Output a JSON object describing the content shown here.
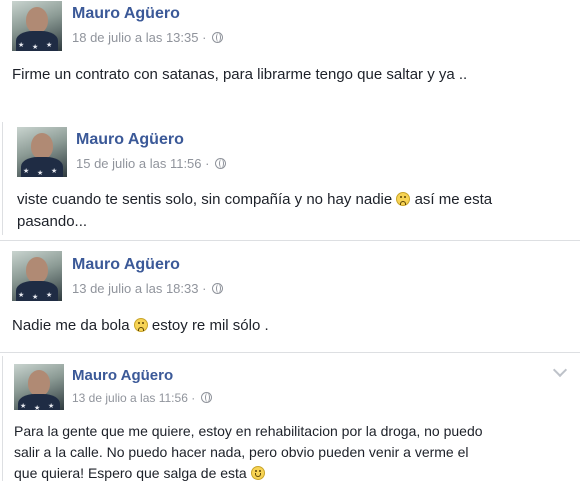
{
  "posts": [
    {
      "author": "Mauro Agüero",
      "date": "18 de julio a las 13:35",
      "separator": "·",
      "text": "Firme un contrato con satanas, para librarme tengo que saltar y ya .."
    },
    {
      "author": "Mauro Agüero",
      "date": "15 de julio a las 11:56",
      "separator": "·",
      "text_line1_a": "viste cuando te sentis solo, sin compañía y no hay nadie",
      "text_line1_b": "así me esta",
      "text_line2": "pasando..."
    },
    {
      "author": "Mauro Agüero",
      "date": "13 de julio a las 18:33",
      "separator": "·",
      "text_a": "Nadie me da bola",
      "text_b": "estoy re mil sólo ."
    },
    {
      "author": "Mauro Agüero",
      "date": "13 de julio a las 11:56",
      "separator": "·",
      "text_line1": "Para la gente que me quiere, estoy en rehabilitacion por la droga, no puedo",
      "text_line2": "salir a la calle. No puedo hacer nada, pero obvio pueden venir a verme el",
      "text_line3": "que quiera! Espero que salga de esta"
    }
  ],
  "icons": {
    "privacy": "globe-icon",
    "frown": "frown-emoji-icon",
    "smile": "smile-emoji-icon",
    "menu": "chevron-down-icon"
  },
  "colors": {
    "author": "#3b5998",
    "meta": "#90949c",
    "text": "#1d2129",
    "separator": "#dddfe2"
  }
}
